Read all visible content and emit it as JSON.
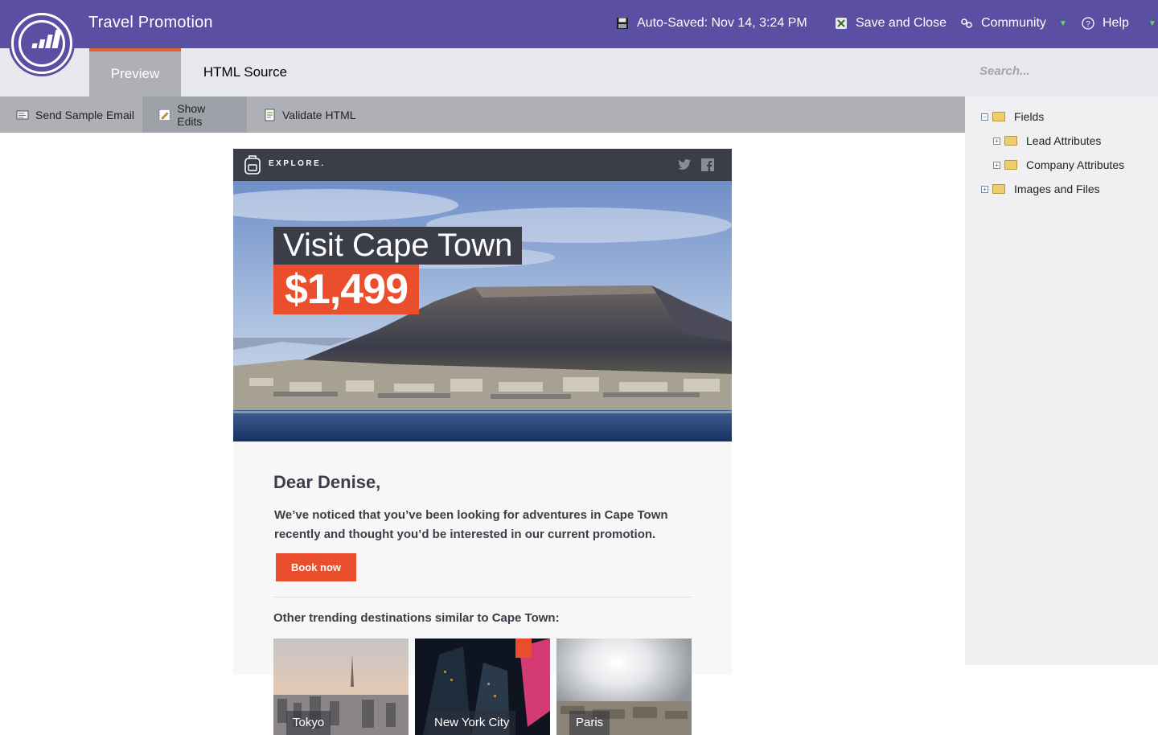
{
  "app": {
    "title": "Travel Promotion",
    "autosave": "Auto-Saved: Nov 14, 3:24 PM",
    "save_close": "Save and Close",
    "community": "Community",
    "help": "Help",
    "brand_color": "#5a4fa3"
  },
  "tabs": [
    {
      "label": "Preview",
      "active": true
    },
    {
      "label": "HTML Source",
      "active": false
    }
  ],
  "search": {
    "placeholder": "Search..."
  },
  "toolbar": {
    "send_sample": "Send Sample Email",
    "show_edits": "Show Edits",
    "validate": "Validate HTML"
  },
  "tree": [
    {
      "label": "Fields",
      "expanded": true
    },
    {
      "label": "Lead Attributes",
      "expanded": false
    },
    {
      "label": "Company Attributes",
      "expanded": false
    },
    {
      "label": "Images and Files",
      "expanded": false
    }
  ],
  "email": {
    "brand": "EXPLORE.",
    "hero_title": "Visit Cape Town",
    "hero_price": "$1,499",
    "greeting": "Dear Denise,",
    "body": "We’ve noticed that you’ve been looking for adventures in Cape Town recently and thought you’d be interested in our current promotion.",
    "cta": "Book now",
    "trending": "Other trending destinations similar to Cape Town:",
    "destinations": [
      "Tokyo",
      "New York City",
      "Paris"
    ],
    "accent_color": "#ea4e2d"
  }
}
